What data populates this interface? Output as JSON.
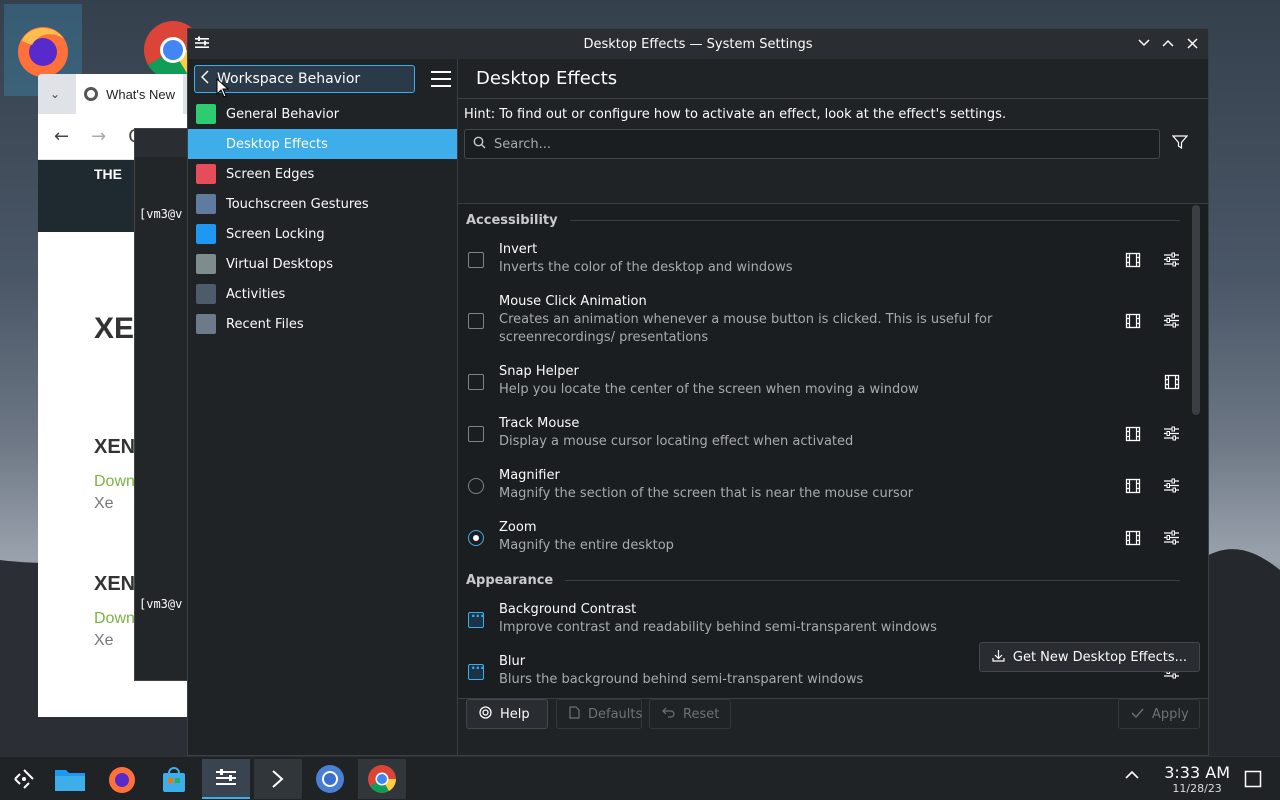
{
  "window": {
    "title": "Desktop Effects — System Settings"
  },
  "sidebar": {
    "back_label": "Workspace Behavior",
    "items": [
      {
        "label": "General Behavior",
        "icon": "general-behavior-icon",
        "color": "#2ecc71"
      },
      {
        "label": "Desktop Effects",
        "icon": "desktop-effects-icon",
        "color": "#3daee9",
        "active": true
      },
      {
        "label": "Screen Edges",
        "icon": "screen-edges-icon",
        "color": "#e74c5a"
      },
      {
        "label": "Touchscreen Gestures",
        "icon": "touchscreen-gestures-icon",
        "color": "#5f7c9e"
      },
      {
        "label": "Screen Locking",
        "icon": "screen-locking-icon",
        "color": "#1d99f3"
      },
      {
        "label": "Virtual Desktops",
        "icon": "virtual-desktops-icon",
        "color": "#7f8c8d"
      },
      {
        "label": "Activities",
        "icon": "activities-icon",
        "color": "#4d5b6a"
      },
      {
        "label": "Recent Files",
        "icon": "recent-files-icon",
        "color": "#6c7a89"
      }
    ]
  },
  "main": {
    "heading": "Desktop Effects",
    "hint": "Hint: To find out or configure how to activate an effect, look at the effect's settings.",
    "search_placeholder": "Search...",
    "sections": {
      "accessibility": "Accessibility",
      "appearance": "Appearance"
    },
    "effects": [
      {
        "name": "Invert",
        "desc": "Inverts the color of the desktop and windows",
        "control": "checkbox",
        "checked": false,
        "video": true,
        "configure": true
      },
      {
        "name": "Mouse Click Animation",
        "desc": "Creates an animation whenever a mouse button is clicked. This is useful for screenrecordings/ presentations",
        "control": "checkbox",
        "checked": false,
        "video": true,
        "configure": true
      },
      {
        "name": "Snap Helper",
        "desc": "Help you locate the center of the screen when moving a window",
        "control": "checkbox",
        "checked": false,
        "video": true,
        "configure": false
      },
      {
        "name": "Track Mouse",
        "desc": "Display a mouse cursor locating effect when activated",
        "control": "checkbox",
        "checked": false,
        "video": true,
        "configure": true
      },
      {
        "name": "Magnifier",
        "desc": "Magnify the section of the screen that is near the mouse cursor",
        "control": "radio",
        "checked": false,
        "video": true,
        "configure": true
      },
      {
        "name": "Zoom",
        "desc": "Magnify the entire desktop",
        "control": "radio",
        "checked": true,
        "video": true,
        "configure": true
      },
      {
        "name": "Background Contrast",
        "desc": "Improve contrast and readability behind semi-transparent windows",
        "control": "checkbox-default",
        "checked": true,
        "video": false,
        "configure": false
      },
      {
        "name": "Blur",
        "desc": "Blurs the background behind semi-transparent windows",
        "control": "checkbox-default",
        "checked": true,
        "video": false,
        "configure": true
      }
    ],
    "buttons": {
      "get_new": "Get New Desktop Effects...",
      "help": "Help",
      "defaults": "Defaults",
      "reset": "Reset",
      "apply": "Apply"
    }
  },
  "background": {
    "browser_tab": "What's New",
    "browser_site_letters": "THE",
    "browser_big": "XE",
    "browser_h2a": "XEN",
    "browser_h2b": "XEN",
    "browser_green": "Down",
    "browser_tag": "Xe",
    "terminal_line1": "[vm3@v",
    "terminal_line2": "[vm3@v"
  },
  "taskbar": {
    "time": "3:33 AM",
    "date": "11/28/23"
  },
  "colors": {
    "accent": "#3daee9",
    "window_bg": "#202326",
    "list_bg": "#1b1e20"
  }
}
